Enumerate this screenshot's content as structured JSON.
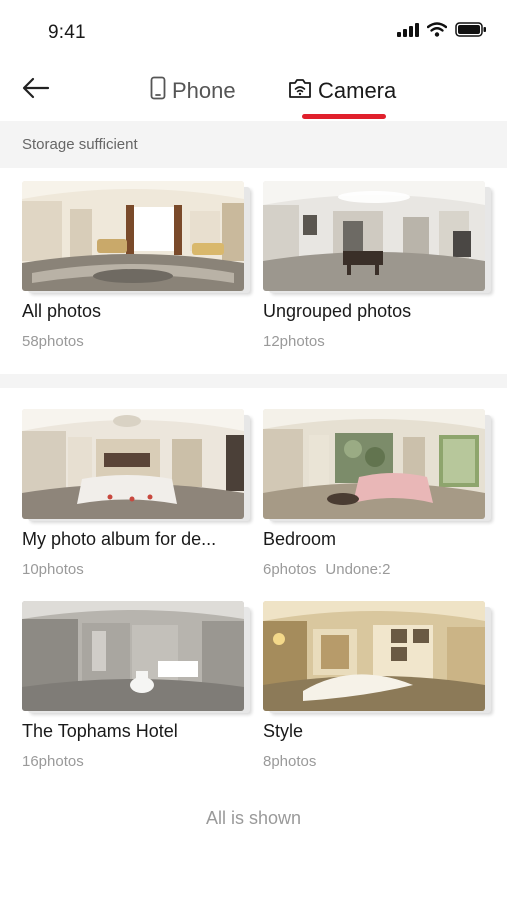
{
  "status": {
    "time": "9:41"
  },
  "nav": {
    "tabs": [
      {
        "label": "Phone",
        "icon": "phone-icon"
      },
      {
        "label": "Camera",
        "icon": "camera-icon"
      }
    ],
    "accent": "#e0202c"
  },
  "storage": {
    "text": "Storage sufficient"
  },
  "albums": [
    {
      "name": "All photos",
      "count": "58photos"
    },
    {
      "name": "Ungrouped photos",
      "count": "12photos"
    },
    {
      "name": "My photo album for de...",
      "count": "10photos"
    },
    {
      "name": "Bedroom",
      "count": "6photos",
      "undone": "Undone:2"
    },
    {
      "name": "The Tophams Hotel",
      "count": "16photos"
    },
    {
      "name": "Style",
      "count": "8photos"
    }
  ],
  "footer": {
    "text": "All is shown"
  }
}
